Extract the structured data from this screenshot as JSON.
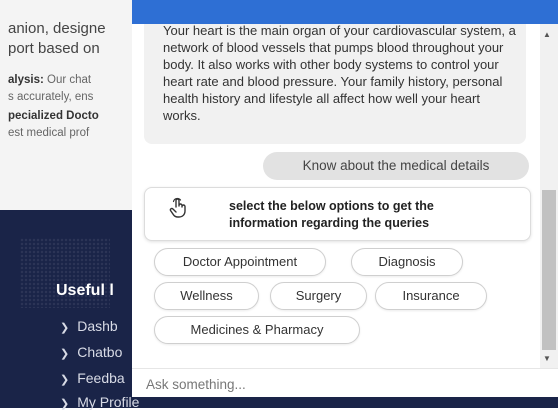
{
  "background": {
    "intro_line1": "anion, designe",
    "intro_line2": "port based on",
    "analysis_label": "alysis:",
    "analysis_text": " Our chat",
    "accuracy_text": "s accurately, ens",
    "specialized_text": "pecialized Docto",
    "medical_text": "est medical prof",
    "footer_heading": "Useful l",
    "footer_links": [
      "Dashb",
      "Chatbo",
      "Feedba",
      "My Profile"
    ]
  },
  "chat": {
    "bot_message": "Your heart is the main organ of your cardiovascular system, a network of blood vessels that pumps blood throughout your body. It also works with other body systems to control your heart rate and blood pressure. Your family history, personal health history and lifestyle all affect how well your heart works.",
    "user_message": "Know about the medical details",
    "options_prompt": "select the below options to get the information regarding the queries",
    "options": [
      "Doctor Appointment",
      "Diagnosis",
      "Wellness",
      "Surgery",
      "Insurance",
      "Medicines & Pharmacy"
    ],
    "input_placeholder": "Ask something..."
  },
  "colors": {
    "header_blue": "#2e6fd4",
    "footer_navy": "#1a2448"
  },
  "icons": [
    "hand-pointer-icon",
    "chevron-right-icon",
    "scroll-up-arrow-icon",
    "scroll-down-arrow-icon"
  ]
}
